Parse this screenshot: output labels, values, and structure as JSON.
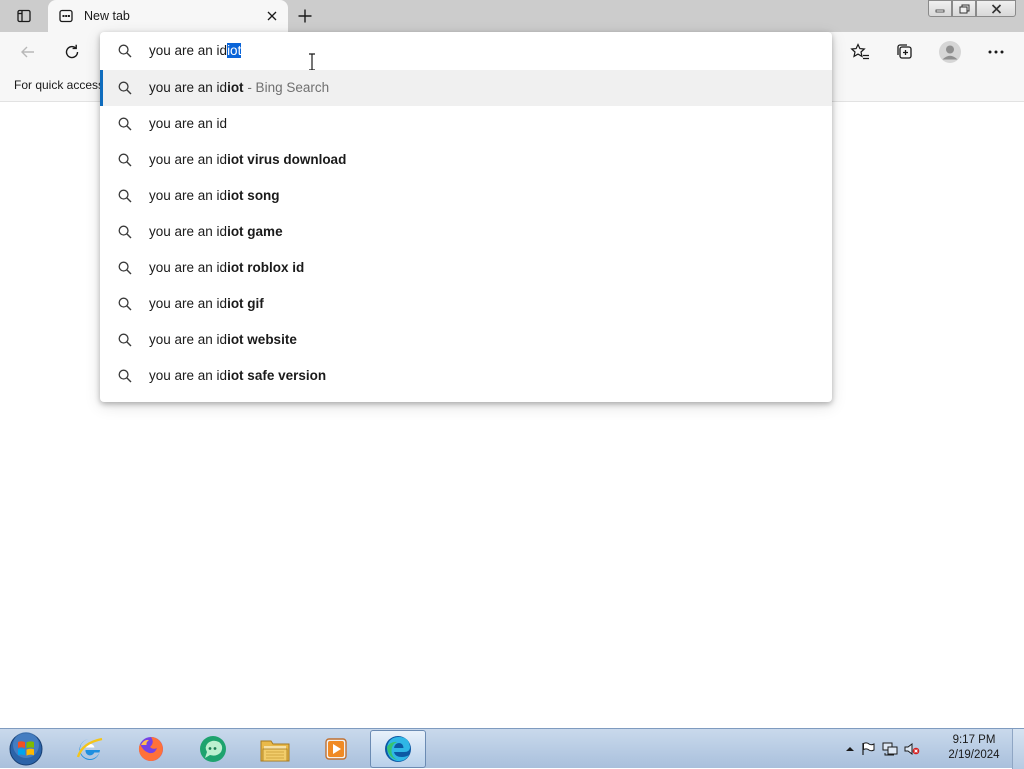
{
  "tabs": [
    {
      "title": "New tab",
      "active": true
    }
  ],
  "address_bar": {
    "typed": "you are an id",
    "autocomplete": "iot"
  },
  "favorites_bar": {
    "text": "For quick access"
  },
  "suggestions": [
    {
      "plain": "you are an id",
      "bold": "iot",
      "hint": " - Bing Search",
      "active": true
    },
    {
      "plain": "you are an id",
      "bold": "",
      "hint": "",
      "active": false
    },
    {
      "plain": "you are an id",
      "bold": "iot virus download",
      "hint": "",
      "active": false
    },
    {
      "plain": "you are an id",
      "bold": "iot song",
      "hint": "",
      "active": false
    },
    {
      "plain": "you are an id",
      "bold": "iot game",
      "hint": "",
      "active": false
    },
    {
      "plain": "you are an id",
      "bold": "iot roblox id",
      "hint": "",
      "active": false
    },
    {
      "plain": "you are an id",
      "bold": "iot gif",
      "hint": "",
      "active": false
    },
    {
      "plain": "you are an id",
      "bold": "iot website",
      "hint": "",
      "active": false
    },
    {
      "plain": "you are an id",
      "bold": "iot safe version",
      "hint": "",
      "active": false
    }
  ],
  "taskbar": {
    "apps": [
      {
        "name": "internet-explorer-icon",
        "active": false
      },
      {
        "name": "firefox-icon",
        "active": false
      },
      {
        "name": "chat-app-icon",
        "active": false
      },
      {
        "name": "file-explorer-icon",
        "active": false
      },
      {
        "name": "media-player-icon",
        "active": false
      },
      {
        "name": "edge-icon",
        "active": true
      }
    ],
    "clock": {
      "time": "9:17 PM",
      "date": "2/19/2024"
    }
  },
  "colors": {
    "accent": "#0f6cbd",
    "selection": "#0a64d8",
    "tabstrip": "#cccccc",
    "toolbar": "#f7f7f7",
    "taskbar": "#b9cde6"
  }
}
